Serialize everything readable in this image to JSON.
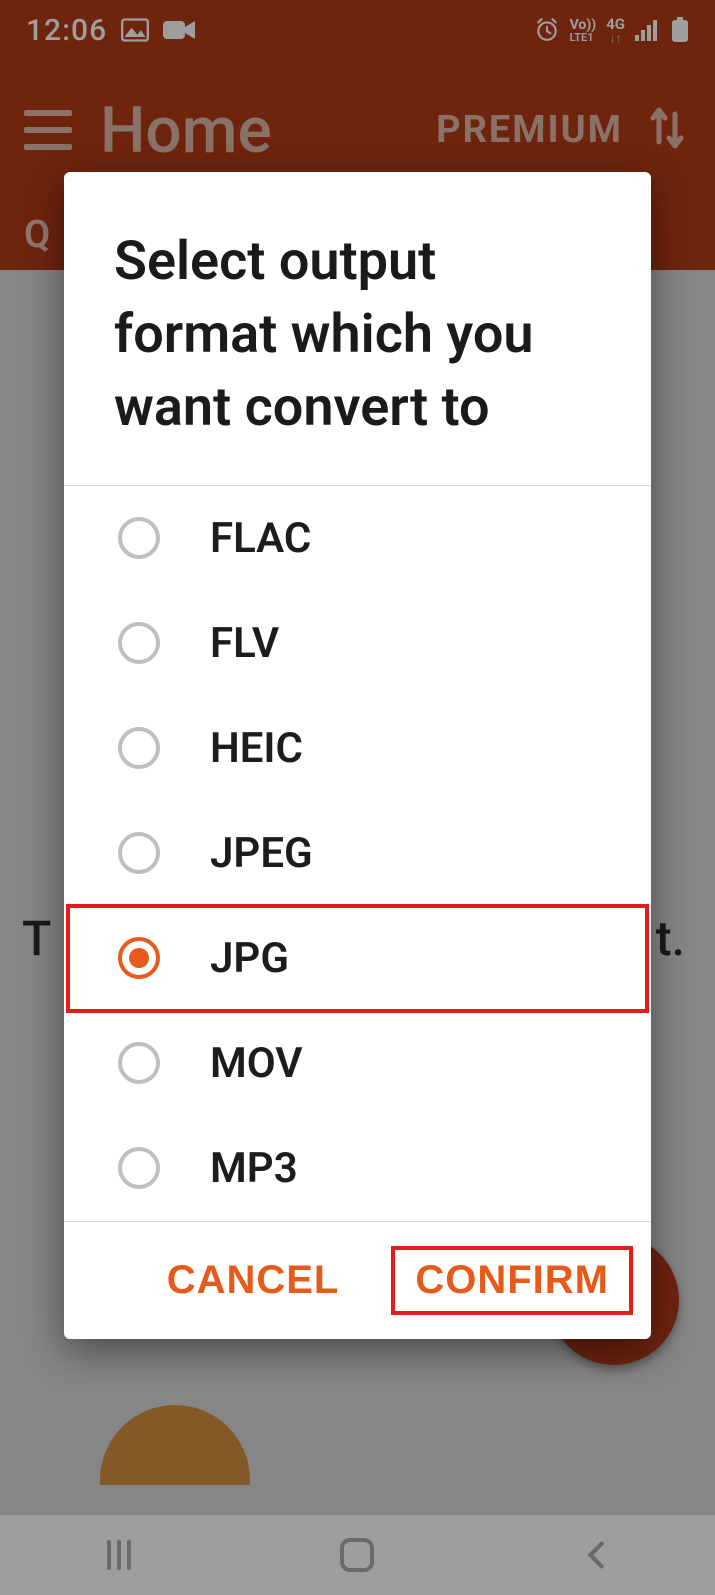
{
  "status": {
    "time": "12:06",
    "net_top": "Vo))",
    "net_bottom": "LTE1",
    "fourg": "4G"
  },
  "header": {
    "title": "Home",
    "premium": "PREMIUM"
  },
  "subheader_visible_letter": "Q",
  "background": {
    "left_letter": "T",
    "right_fragment": "t."
  },
  "dialog": {
    "title": "Select output format which you want convert to",
    "options": [
      {
        "label": "FLAC",
        "selected": false
      },
      {
        "label": "FLV",
        "selected": false
      },
      {
        "label": "HEIC",
        "selected": false
      },
      {
        "label": "JPEG",
        "selected": false
      },
      {
        "label": "JPG",
        "selected": true
      },
      {
        "label": "MOV",
        "selected": false
      },
      {
        "label": "MP3",
        "selected": false
      }
    ],
    "cancel_label": "CANCEL",
    "confirm_label": "CONFIRM"
  }
}
